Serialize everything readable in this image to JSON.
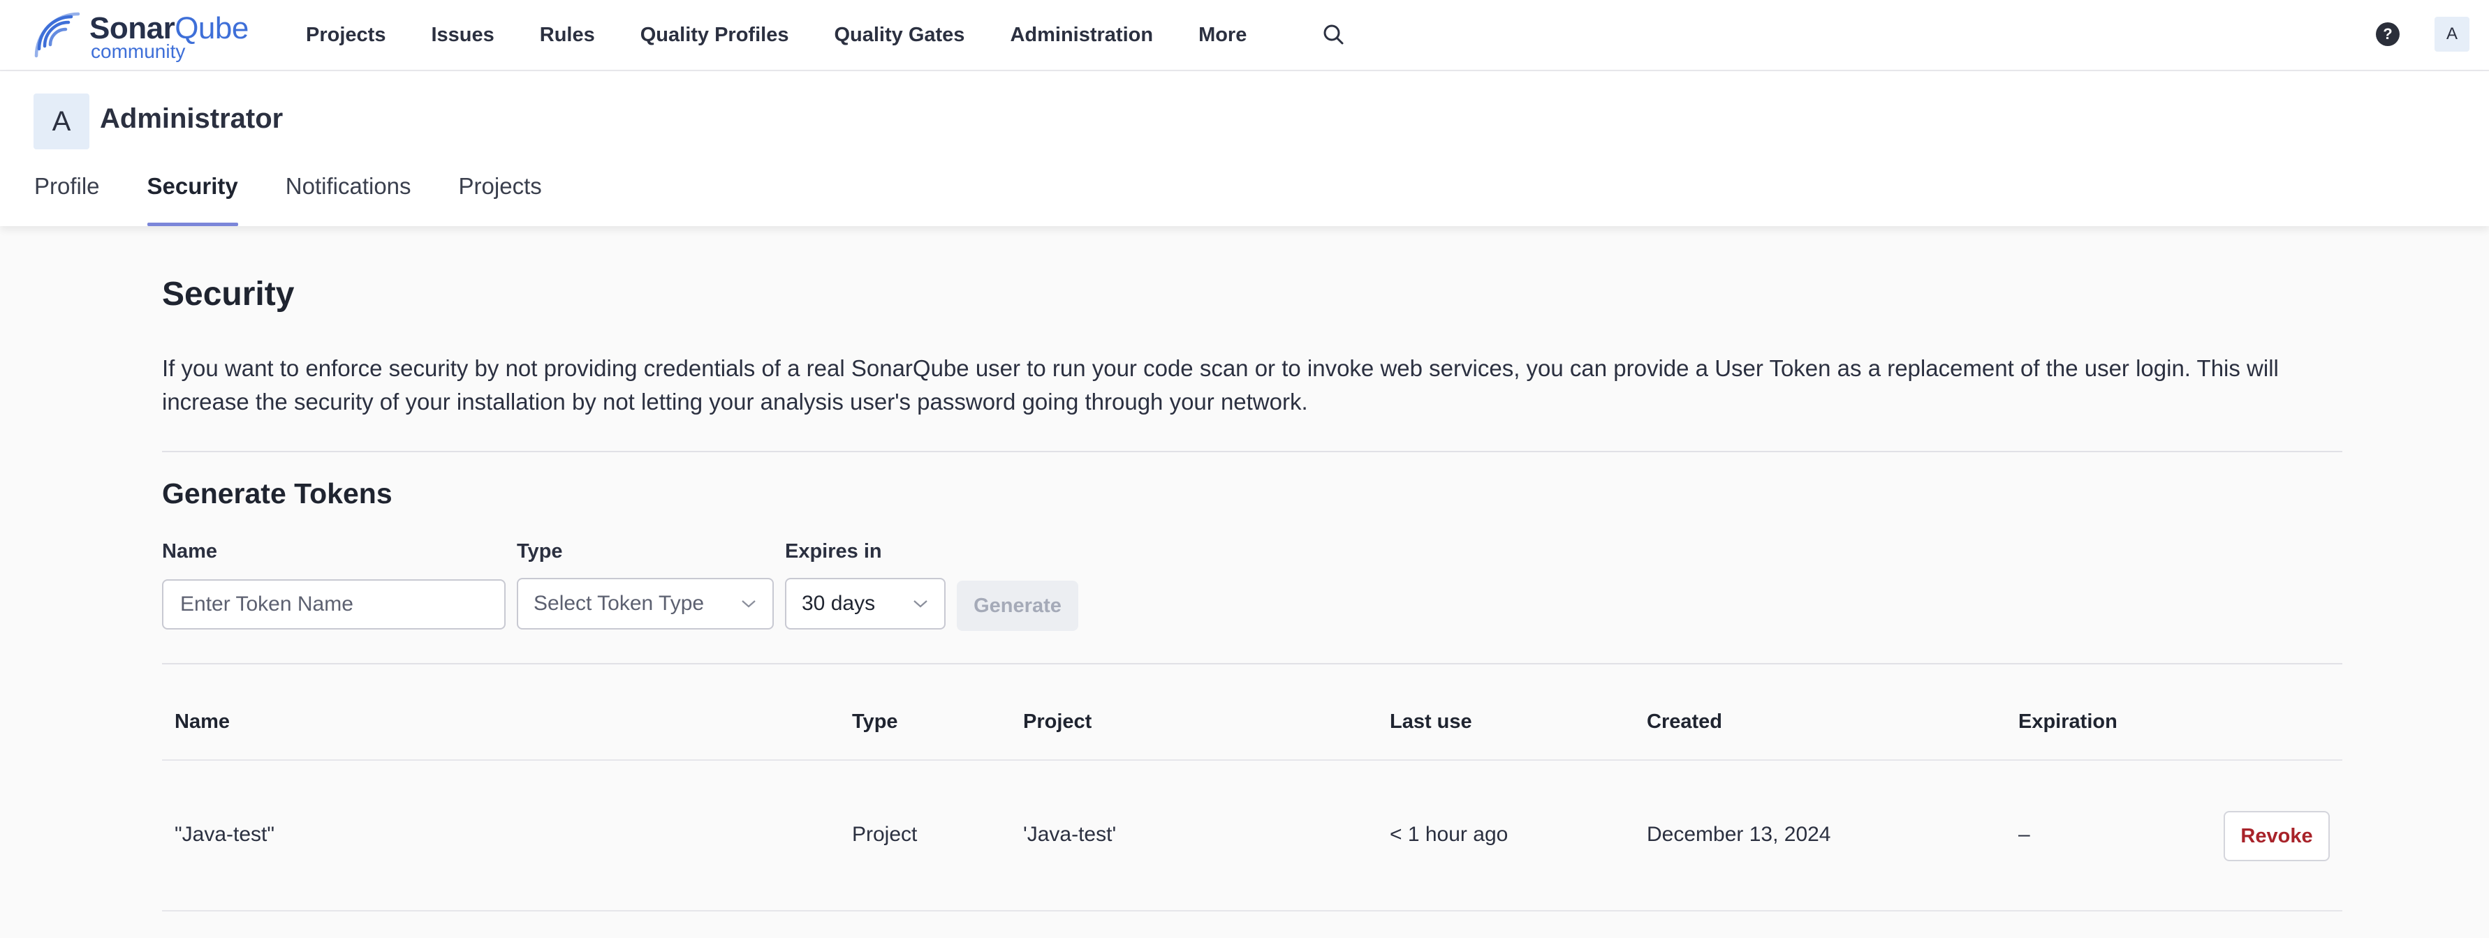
{
  "brand": {
    "name_a": "Sonar",
    "name_b": "Qube",
    "edition": "community",
    "icon": "sonarqube-logo-icon"
  },
  "nav": {
    "items": [
      {
        "label": "Projects"
      },
      {
        "label": "Issues"
      },
      {
        "label": "Rules"
      },
      {
        "label": "Quality Profiles"
      },
      {
        "label": "Quality Gates"
      },
      {
        "label": "Administration"
      },
      {
        "label": "More"
      }
    ],
    "search_icon": "search-icon",
    "help_icon": "help-icon",
    "help_glyph": "?",
    "avatar_initial": "A"
  },
  "account": {
    "avatar_initial": "A",
    "name": "Administrator",
    "tabs": [
      {
        "label": "Profile",
        "active": false
      },
      {
        "label": "Security",
        "active": true
      },
      {
        "label": "Notifications",
        "active": false
      },
      {
        "label": "Projects",
        "active": false
      }
    ]
  },
  "security": {
    "title": "Security",
    "intro": "If you want to enforce security by not providing credentials of a real SonarQube user to run your code scan or to invoke web services, you can provide a User Token as a replacement of the user login. This will increase the security of your installation by not letting your analysis user's password going through your network."
  },
  "generate": {
    "title": "Generate Tokens",
    "name_label": "Name",
    "name_placeholder": "Enter Token Name",
    "name_value": "",
    "type_label": "Type",
    "type_placeholder": "Select Token Type",
    "expires_label": "Expires in",
    "expires_value": "30 days",
    "button_label": "Generate",
    "button_disabled": true
  },
  "tokens": {
    "columns": [
      "Name",
      "Type",
      "Project",
      "Last use",
      "Created",
      "Expiration"
    ],
    "rows": [
      {
        "name": "\"Java-test\"",
        "type": "Project",
        "project": "'Java-test'",
        "last_use": "< 1 hour ago",
        "created": "December 13, 2024",
        "expiration": "–",
        "action": "Revoke"
      }
    ]
  },
  "colors": {
    "accent_tab": "#7b86d9",
    "brand_blue": "#3e6fd8",
    "revoke_red": "#a8232a",
    "background": "#fafafa"
  }
}
